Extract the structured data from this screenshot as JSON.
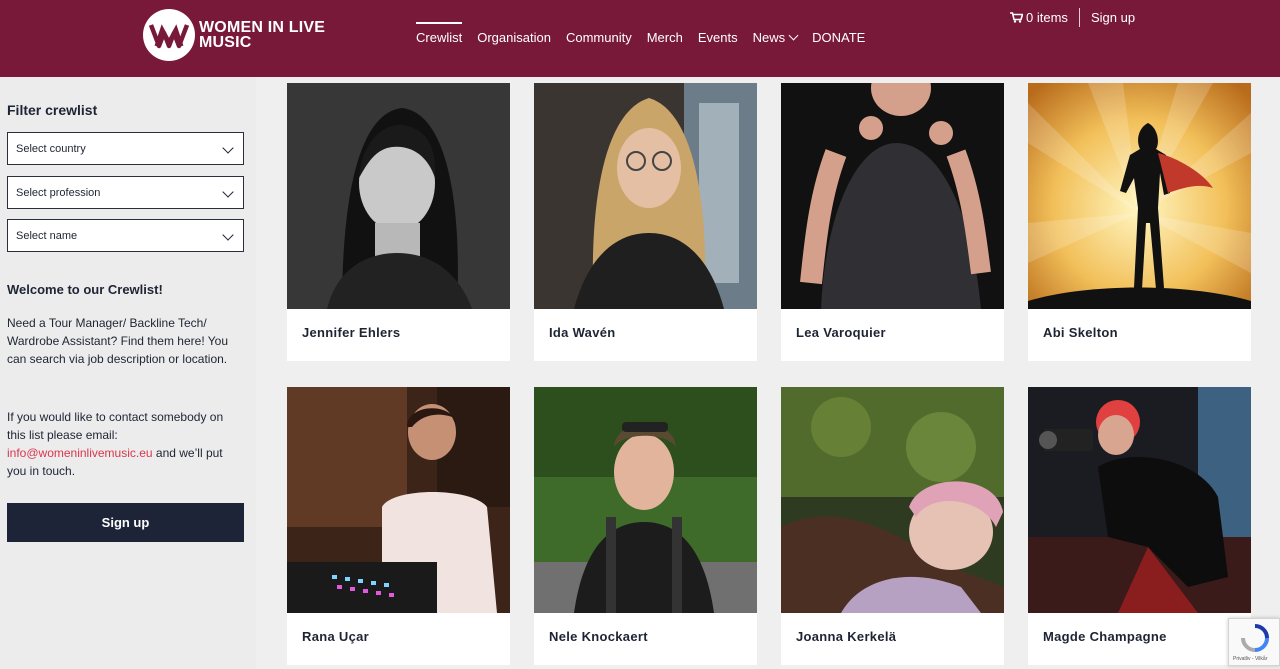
{
  "header": {
    "logo_text_line1": "WOMEN IN LIVE",
    "logo_text_line2": "MUSIC",
    "nav": [
      "Crewlist",
      "Organisation",
      "Community",
      "Merch",
      "Events",
      "News",
      "DONATE"
    ],
    "cart_label": "0 items",
    "signup_label": "Sign up",
    "brand_color": "#79193a"
  },
  "sidebar": {
    "filter_title": "Filter crewlist",
    "selects": [
      "Select country",
      "Select profession",
      "Select name"
    ],
    "welcome_title": "Welcome to our Crewlist!",
    "intro": "Need a Tour Manager/ Backline Tech/ Wardrobe Assistant? Find them here! You can search via job description or location.",
    "contact_before": "If you would like to contact somebody on this list please email: ",
    "contact_email": "info@womeninlivemusic.eu",
    "contact_after": " and we’ll put you in touch.",
    "signup_button": "Sign up"
  },
  "crew": [
    {
      "name": "Jennifer Ehlers",
      "photo": "portrait-bw-icon"
    },
    {
      "name": "Ida Wavén",
      "photo": "portrait-blonde-icon"
    },
    {
      "name": "Lea Varoquier",
      "photo": "portrait-rock-icon"
    },
    {
      "name": "Abi Skelton",
      "photo": "superhero-silhouette-icon"
    },
    {
      "name": "Rana Uçar",
      "photo": "portrait-dj-icon"
    },
    {
      "name": "Nele Knockaert",
      "photo": "portrait-outdoor-icon"
    },
    {
      "name": "Joanna Kerkelä",
      "photo": "portrait-moss-icon"
    },
    {
      "name": "Magde Champagne",
      "photo": "portrait-photographer-icon"
    }
  ],
  "recaptcha": {
    "label": "Privatliv - Vilkår"
  }
}
